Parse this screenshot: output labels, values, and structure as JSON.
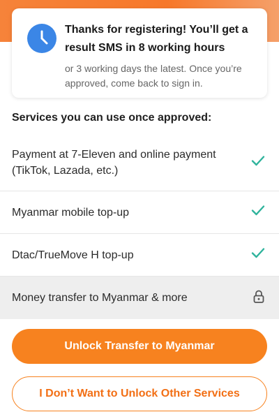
{
  "notice": {
    "icon": "clock-icon",
    "title": "Thanks for registering! You’ll get a result SMS in 8 working hours",
    "subtitle": "or 3 working days the latest. Once you’re approved, come back to sign in."
  },
  "services": {
    "heading": "Services you can use once approved:",
    "items": [
      {
        "label": "Payment at 7-Eleven and online payment (TikTok, Lazada, etc.)",
        "status": "check-icon"
      },
      {
        "label": "Myanmar mobile top-up",
        "status": "check-icon"
      },
      {
        "label": "Dtac/TrueMove H top-up",
        "status": "check-icon"
      },
      {
        "label": "Money transfer to Myanmar & more",
        "status": "lock-icon"
      }
    ]
  },
  "actions": {
    "unlock_label": "Unlock Transfer to Myanmar",
    "decline_label": "I Don’t Want to Unlock Other Services"
  },
  "colors": {
    "accent": "#f7821f",
    "check": "#2fb39c",
    "clock": "#3b86e6"
  }
}
